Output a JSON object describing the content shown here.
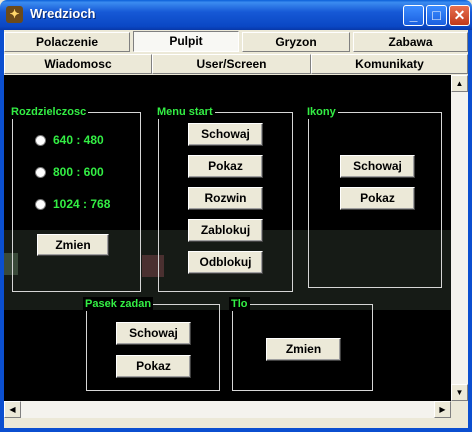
{
  "window": {
    "title": "Wredzioch",
    "icon": "app-icon"
  },
  "tabs_row1": [
    {
      "label": "Polaczenie",
      "active": false
    },
    {
      "label": "Pulpit",
      "active": true
    },
    {
      "label": "Gryzon",
      "active": false
    },
    {
      "label": "Zabawa",
      "active": false
    }
  ],
  "tabs_row2": [
    {
      "label": "Wiadomosc"
    },
    {
      "label": "User/Screen"
    },
    {
      "label": "Komunikaty"
    }
  ],
  "groups": {
    "resolution": {
      "title": "Rozdzielczosc",
      "options": [
        "640 : 480",
        "800 : 600",
        "1024 : 768"
      ],
      "button": "Zmien"
    },
    "start_menu": {
      "title": "Menu start",
      "buttons": [
        "Schowaj",
        "Pokaz",
        "Rozwin",
        "Zablokuj",
        "Odblokuj"
      ]
    },
    "icons": {
      "title": "Ikony",
      "buttons": [
        "Schowaj",
        "Pokaz"
      ]
    },
    "taskbar": {
      "title": "Pasek zadan",
      "buttons": [
        "Schowaj",
        "Pokaz"
      ]
    },
    "background": {
      "title": "Tlo",
      "button": "Zmien"
    }
  },
  "colors": {
    "accent_green": "#33ee44",
    "panel_bg": "#000000",
    "title_blue": "#0a47c4"
  }
}
